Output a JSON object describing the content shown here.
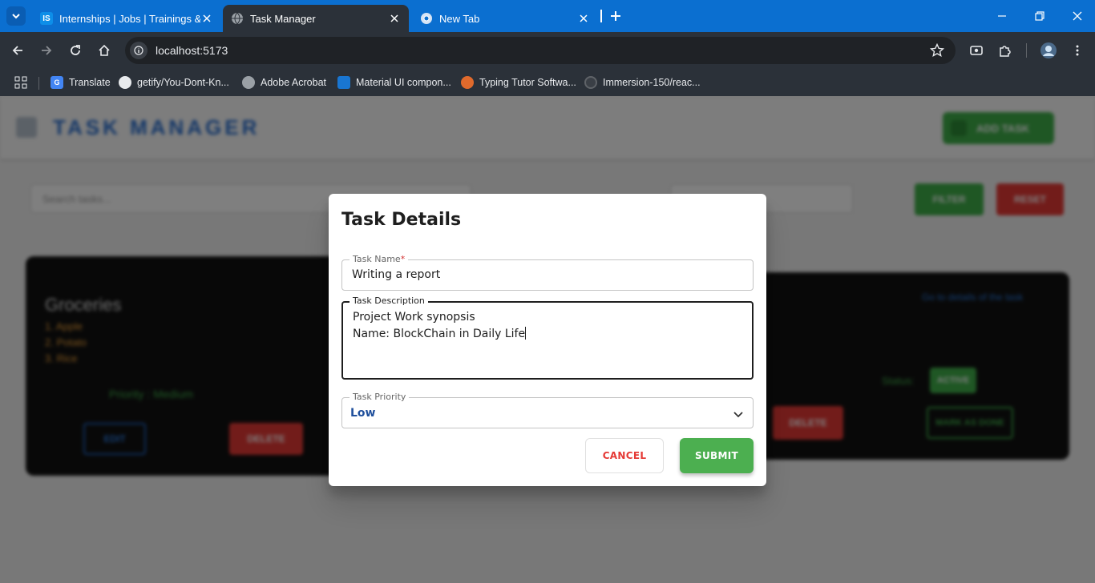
{
  "browser": {
    "tabs": [
      {
        "title": "Internships | Jobs | Trainings & Online...",
        "favicon": "IS"
      },
      {
        "title": "Task Manager"
      },
      {
        "title": "New Tab"
      }
    ],
    "url": "localhost:5173",
    "bookmarks": [
      {
        "label": "Translate"
      },
      {
        "label": "getify/You-Dont-Kn..."
      },
      {
        "label": "Adobe Acrobat"
      },
      {
        "label": "Material UI compon..."
      },
      {
        "label": "Typing Tutor Softwa..."
      },
      {
        "label": "Immersion-150/reac..."
      }
    ],
    "colors": {
      "tabstrip": "#0b6fd0",
      "toolbar": "#2b3139"
    }
  },
  "app": {
    "brand_title": "TASK MANAGER",
    "add_task_label": "ADD TASK",
    "search_placeholder": "Search tasks...",
    "filter_label": "FILTER",
    "reset_label": "RESET",
    "cards": [
      {
        "title": "Groceries",
        "items": [
          "1. Apple",
          "2. Potato",
          "3. Rice"
        ],
        "priority": "Priority : Medium",
        "edit_label": "EDIT",
        "delete_label": "DELETE"
      },
      {
        "link": "Go to details of the task",
        "status_label": "Status:",
        "status_value": "ACTIVE",
        "delete_label": "DELETE",
        "mark_label": "MARK AS DONE"
      }
    ]
  },
  "dialog": {
    "title": "Task Details",
    "task_name": {
      "label": "Task Name",
      "required_mark": "*",
      "value": "Writing a report"
    },
    "task_description": {
      "label": "Task Description",
      "lines": [
        "Project Work synopsis",
        "Name: BlockChain in Daily Life"
      ]
    },
    "task_priority": {
      "label": "Task Priority",
      "value": "Low"
    },
    "cancel_label": "CANCEL",
    "submit_label": "SUBMIT",
    "colors": {
      "cancel": "#e53935",
      "submit": "#4caf50",
      "priority_text": "#1f4f9c"
    }
  }
}
